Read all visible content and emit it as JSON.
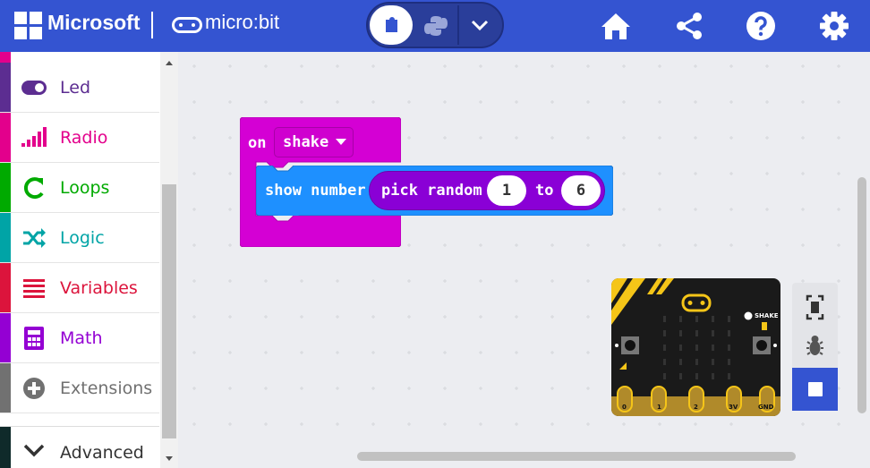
{
  "header": {
    "ms_brand": "Microsoft",
    "app_brand": "micro:bit",
    "editor_modes": [
      "blocks-icon",
      "python-icon",
      "chevron-down-icon"
    ],
    "actions": [
      "home-icon",
      "share-icon",
      "help-icon",
      "gear-icon"
    ]
  },
  "sidebar": {
    "items": [
      {
        "label": "Led",
        "color": "#5c2d91",
        "icon": "toggle-icon"
      },
      {
        "label": "Radio",
        "color": "#e3008c",
        "icon": "signal-bars-icon"
      },
      {
        "label": "Loops",
        "color": "#00aa00",
        "icon": "loop-arrow-icon"
      },
      {
        "label": "Logic",
        "color": "#00a4a6",
        "icon": "shuffle-icon"
      },
      {
        "label": "Variables",
        "color": "#dc143c",
        "icon": "list-lines-icon"
      },
      {
        "label": "Math",
        "color": "#9400d3",
        "icon": "calculator-icon"
      },
      {
        "label": "Extensions",
        "color": "#717171",
        "icon": "plus-circle-icon"
      },
      {
        "label": "Advanced",
        "color": "#333333",
        "icon": "chevron-down-icon"
      }
    ]
  },
  "blocks": {
    "event_on": "on",
    "event_gesture": "shake",
    "show_number": "show number",
    "pick_random": "pick random",
    "from_value": "1",
    "to_label": "to",
    "to_value": "6"
  },
  "simulator": {
    "shake_label": "SHAKE",
    "pins": [
      "0",
      "1",
      "2",
      "3V",
      "GND"
    ],
    "tools": [
      "fullscreen-icon",
      "debug-bug-icon",
      "stop-icon"
    ]
  },
  "colors": {
    "header": "#3454d1",
    "event_block": "#d400d4",
    "basic_block": "#1e90ff",
    "math_block": "#8a00d6"
  }
}
